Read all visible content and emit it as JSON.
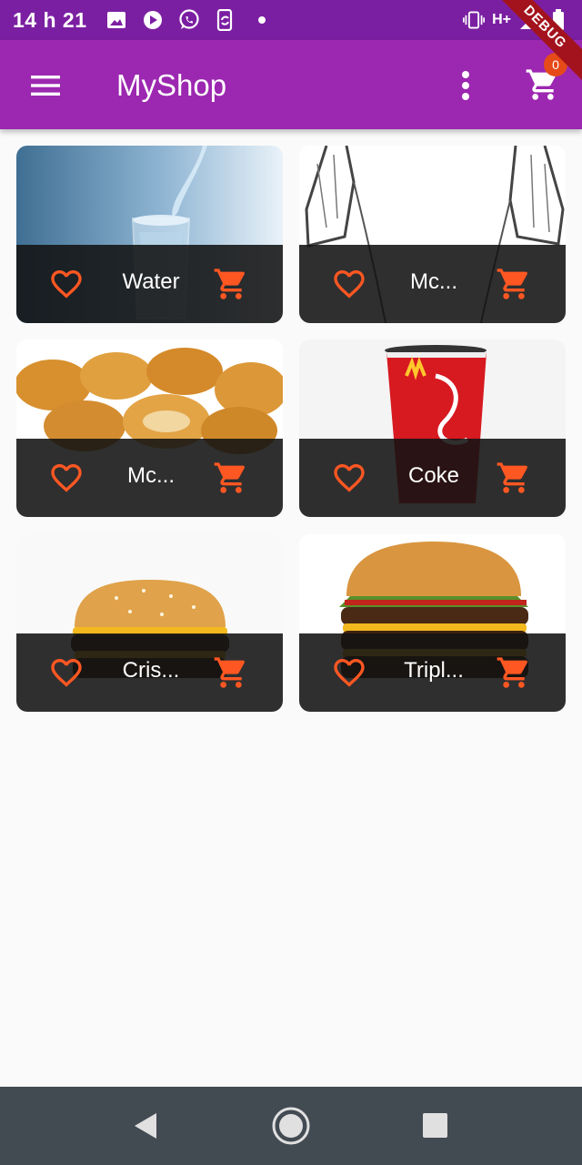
{
  "status_bar": {
    "time": "14 h 21",
    "network": "H+",
    "icons_left": [
      "image-icon",
      "play-icon",
      "whatsapp-icon",
      "phone-sync-icon",
      "dot-icon"
    ],
    "icons_right": [
      "vibrate-icon",
      "signal-icon",
      "battery-icon"
    ]
  },
  "debug_banner": "DEBUG",
  "app_bar": {
    "title": "MyShop",
    "cart_badge": "0",
    "icons": [
      "menu-icon",
      "more-vert-icon",
      "cart-icon"
    ]
  },
  "colors": {
    "status_bar": "#7b1fa2",
    "app_bar": "#9c27b0",
    "accent": "#ff5722",
    "tile_bar": "#121212",
    "nav_bar": "#424a52",
    "background": "#fafafa"
  },
  "products": [
    {
      "title": "Water",
      "image": "glass of water"
    },
    {
      "title": "Mc...",
      "image": "sketch of coat"
    },
    {
      "title": "Mc...",
      "image": "chicken nuggets"
    },
    {
      "title": "Coke",
      "image": "coca-cola cup"
    },
    {
      "title": "Cris...",
      "image": "cheeseburger"
    },
    {
      "title": "Tripl...",
      "image": "triple burger"
    }
  ],
  "nav_bar": {
    "icons": [
      "back-icon",
      "home-icon",
      "recents-icon"
    ]
  }
}
